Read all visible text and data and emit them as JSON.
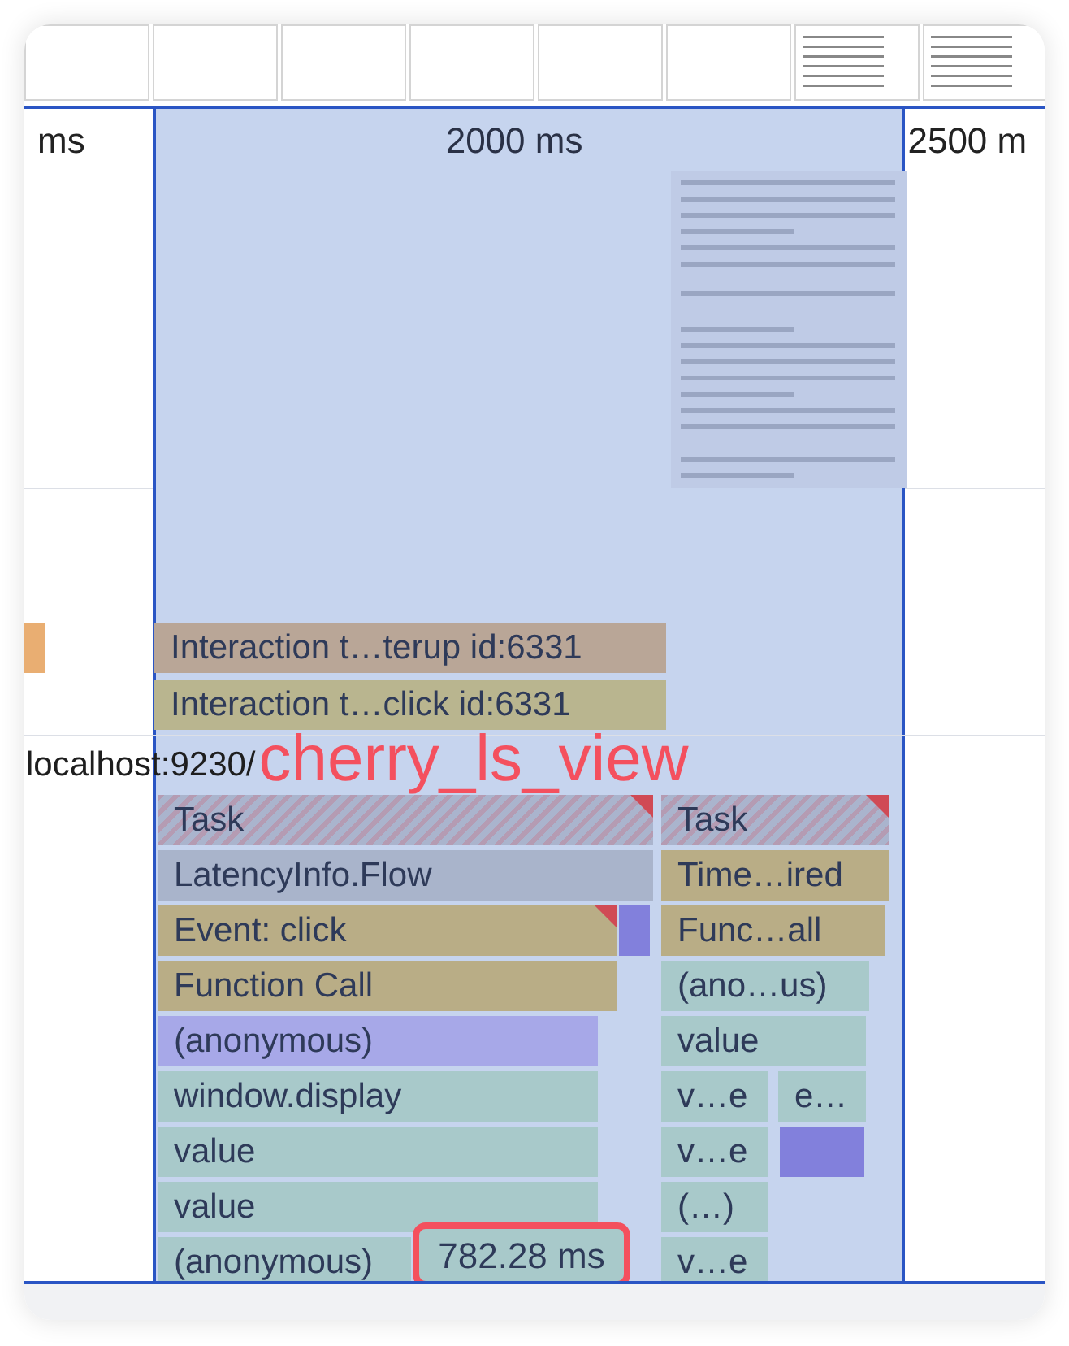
{
  "ruler": {
    "labels": [
      "ms",
      "2000 ms",
      "2500 m"
    ]
  },
  "screenshot": {
    "kind": "picture"
  },
  "interactions": [
    {
      "label": "Interaction t…terup id:6331",
      "color": "#b9a697"
    },
    {
      "label": "Interaction t…click id:6331",
      "color": "#b9b58f"
    }
  ],
  "main_track": {
    "title": "localhost:9230/",
    "annotation": "cherry_ls_view"
  },
  "flame_rows": [
    [
      {
        "label": "Task",
        "kind": "task"
      },
      {
        "label": "Task",
        "kind": "task"
      }
    ],
    [
      {
        "label": "LatencyInfo.Flow",
        "kind": "latency"
      },
      {
        "label": "Time…ired",
        "kind": "event"
      }
    ],
    [
      {
        "label": "Event: click",
        "kind": "event"
      },
      {
        "kind": "block"
      },
      {
        "label": "Func…all",
        "kind": "event"
      }
    ],
    [
      {
        "label": "Function Call",
        "kind": "event"
      },
      {
        "label": "(ano…us)",
        "kind": "script"
      }
    ],
    [
      {
        "label": "(anonymous)",
        "kind": "purple"
      },
      {
        "label": "value",
        "kind": "script"
      }
    ],
    [
      {
        "label": "window.display",
        "kind": "script"
      },
      {
        "label": "v…e",
        "kind": "script"
      },
      {
        "label": "e…",
        "kind": "script"
      }
    ],
    [
      {
        "label": "value",
        "kind": "script"
      },
      {
        "label": "v…e",
        "kind": "script"
      },
      {
        "kind": "block"
      }
    ],
    [
      {
        "label": "value",
        "kind": "script"
      },
      {
        "label": "(…)",
        "kind": "script"
      }
    ],
    [
      {
        "label": "(anonymous)",
        "kind": "script"
      },
      {
        "label": "v…e",
        "kind": "script"
      }
    ]
  ],
  "duration_badge": "782.28 ms"
}
